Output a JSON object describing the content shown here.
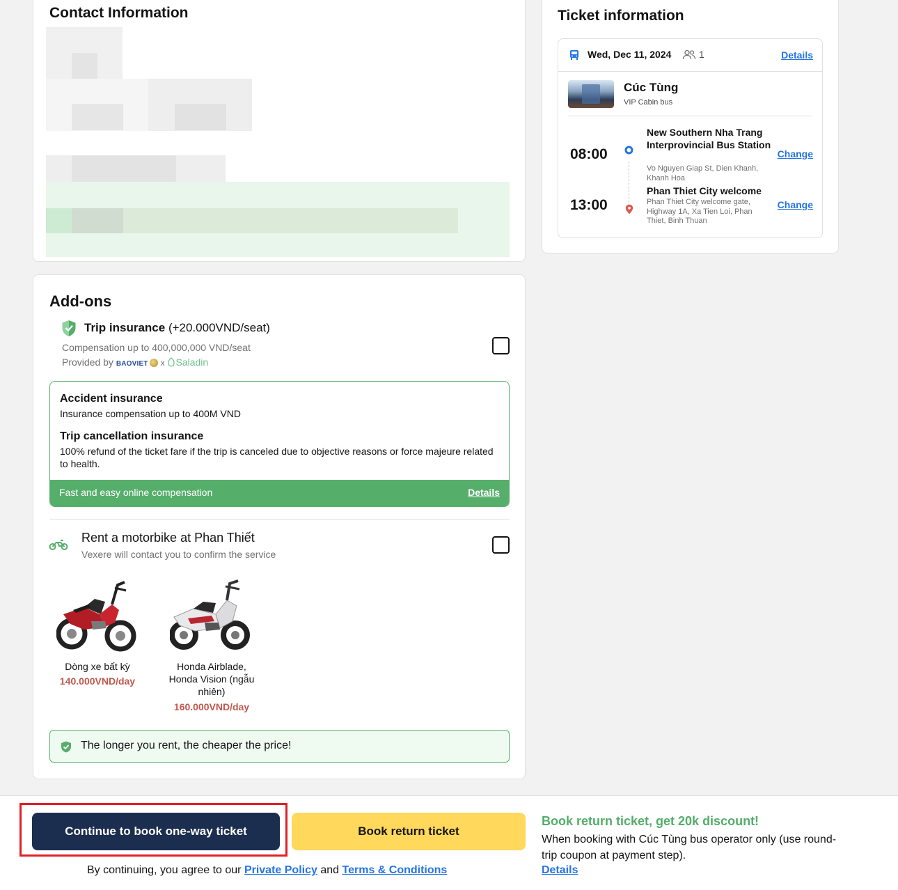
{
  "contact": {
    "title": "Contact Information"
  },
  "ticket": {
    "title": "Ticket information",
    "date": "Wed, Dec 11, 2024",
    "passengers": "1",
    "details_label": "Details",
    "operator": "Cúc Tùng",
    "bus_type": "VIP Cabin bus",
    "departure": {
      "time": "08:00",
      "name": "New Southern Nha Trang Interprovincial Bus Station",
      "address": "Vo Nguyen Giap St, Dien Khanh, Khanh Hoa",
      "change_label": "Change"
    },
    "arrival": {
      "time": "13:00",
      "name": "Phan Thiet City welcome",
      "address": "Phan Thiet City welcome gate, Highway 1A, Xa Tien Loi, Phan Thiet, Binh Thuan",
      "change_label": "Change"
    }
  },
  "addons": {
    "title": "Add-ons",
    "insurance": {
      "name": "Trip insurance",
      "price": "(+20.000VND/seat)",
      "compensation": "Compensation up to 400,000,000 VND/seat",
      "provided_by": "Provided by",
      "brand1": "BAOVIET",
      "x": "x",
      "brand2": "Saladin",
      "item1_title": "Accident insurance",
      "item1_text": "Insurance compensation up to 400M VND",
      "item2_title": "Trip cancellation insurance",
      "item2_text": "100% refund of the ticket fare if the trip is canceled due to objective reasons or force majeure related to health.",
      "footer_text": "Fast and easy online compensation",
      "footer_link": "Details"
    },
    "motorbike": {
      "title": "Rent a motorbike at Phan Thiết",
      "subtitle": "Vexere will contact you to confirm the service",
      "bikes": [
        {
          "name": "Dòng xe bất kỳ",
          "price": "140.000VND/day"
        },
        {
          "name": "Honda Airblade, Honda Vision (ngẫu nhiên)",
          "price": "160.000VND/day"
        }
      ],
      "promo": "The longer you rent, the cheaper the price!"
    }
  },
  "footer": {
    "continue_button": "Continue to book one-way ticket",
    "return_button": "Book return ticket",
    "agree_prefix": "By continuing, you agree to our",
    "privacy_link": "Private Policy",
    "and": "and",
    "terms_link": "Terms & Conditions",
    "promo_title": "Book return ticket, get 20k discount!",
    "promo_text": "When booking with Cúc Tùng bus operator only (use round-trip coupon at payment step).",
    "promo_link": "Details"
  },
  "colors": {
    "primary_button": "#1c2e4f",
    "secondary_button": "#ffd85c",
    "link": "#2474e5",
    "green": "#56ae6b",
    "price_red": "#c0584e",
    "highlight_red": "#e01f26"
  }
}
